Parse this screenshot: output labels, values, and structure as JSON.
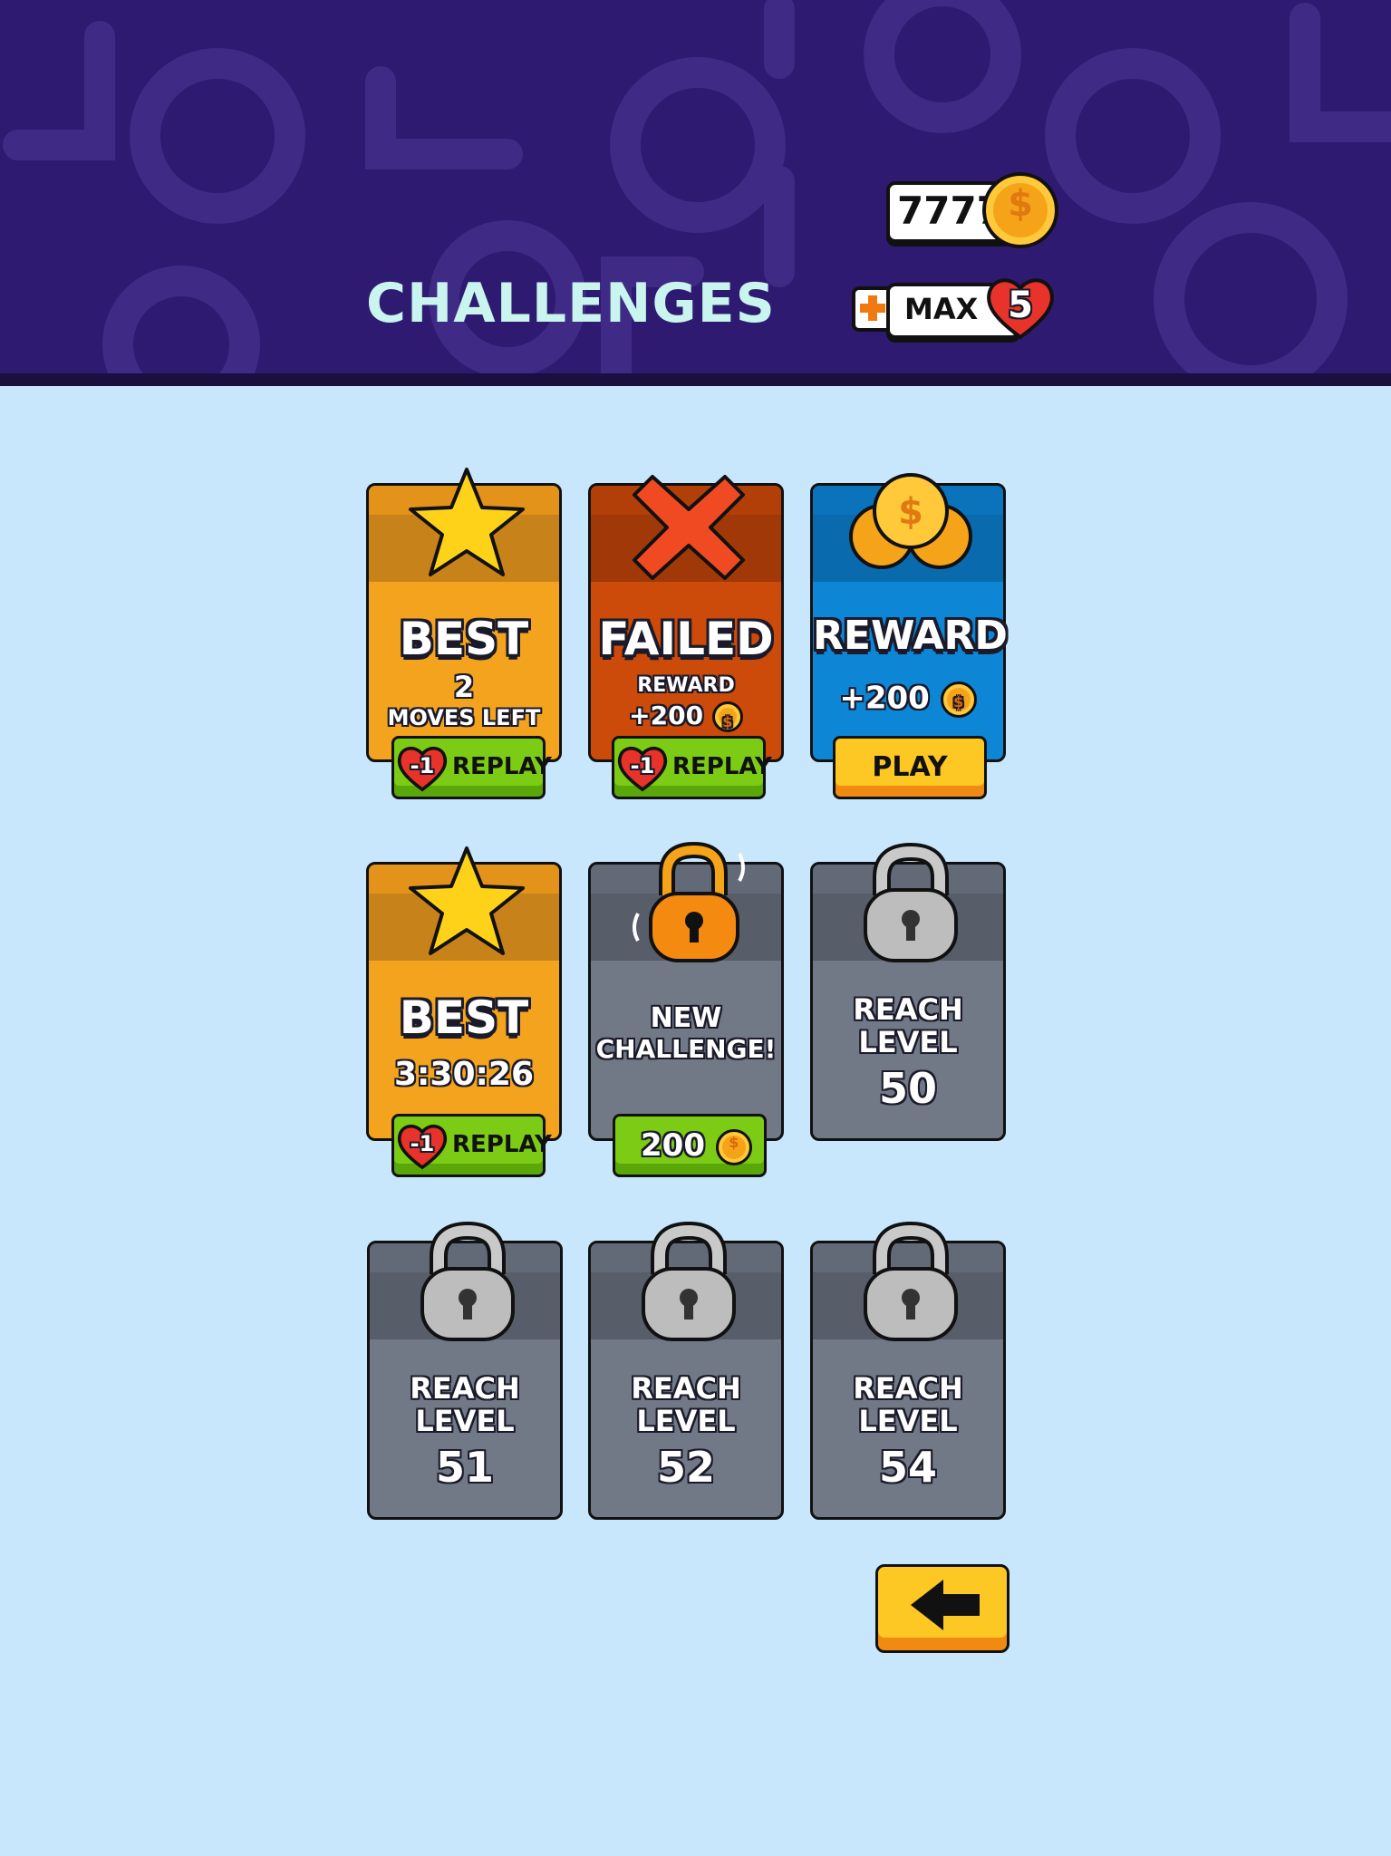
{
  "header": {
    "title": "CHALLENGES",
    "coins": "7777",
    "lives_label": "MAX",
    "lives_count": "5"
  },
  "cards": [
    {
      "state": "best",
      "title": "BEST",
      "line1": "2",
      "line2": "MOVES LEFT",
      "button": "REPLAY",
      "cost": "-1"
    },
    {
      "state": "failed",
      "title": "FAILED",
      "line1": "REWARD",
      "line2": "+200",
      "button": "REPLAY",
      "cost": "-1"
    },
    {
      "state": "reward",
      "title": "REWARD",
      "line1": "+200",
      "button": "PLAY"
    },
    {
      "state": "best",
      "title": "BEST",
      "line1": "3:30:26",
      "button": "REPLAY",
      "cost": "-1"
    },
    {
      "state": "new",
      "title_line1": "NEW",
      "title_line2": "CHALLENGE!",
      "button": "200"
    },
    {
      "state": "locked",
      "line1": "REACH",
      "line2": "LEVEL",
      "level": "50"
    },
    {
      "state": "locked",
      "line1": "REACH",
      "line2": "LEVEL",
      "level": "51"
    },
    {
      "state": "locked",
      "line1": "REACH",
      "line2": "LEVEL",
      "level": "52"
    },
    {
      "state": "locked",
      "line1": "REACH",
      "line2": "LEVEL",
      "level": "54"
    }
  ],
  "colors": {
    "header_bg": "#2e1a70",
    "page_bg": "#c8e6fc",
    "title": "#c9f5ee",
    "best_card": "#f4a31e",
    "failed_card": "#cc4a0a",
    "reward_card": "#0d86d6",
    "locked_card": "#717987",
    "green_button": "#7ccb14",
    "yellow_button": "#fdc824"
  },
  "icons": {
    "coin": "coin-icon",
    "heart": "heart-icon",
    "star": "star-icon",
    "x": "x-icon",
    "lock": "lock-icon",
    "back": "arrow-left-icon"
  }
}
